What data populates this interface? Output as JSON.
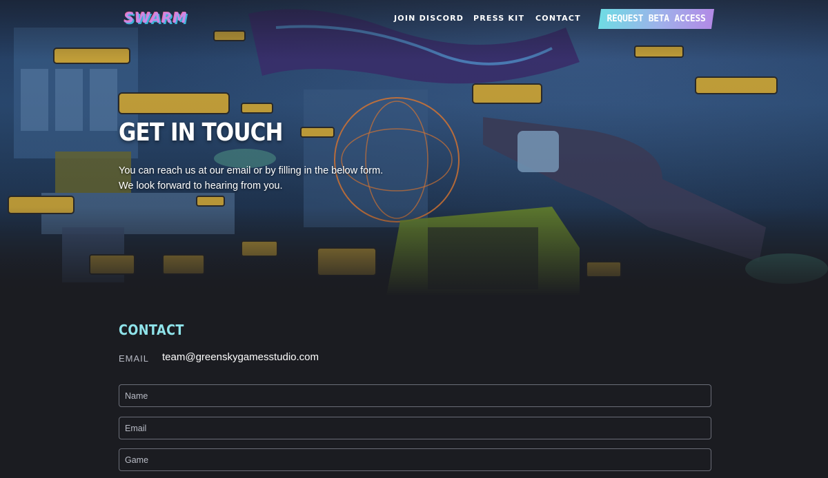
{
  "brand": {
    "logo_text": "SWARM"
  },
  "nav": {
    "links": [
      {
        "label": "JOIN DISCORD"
      },
      {
        "label": "PRESS KIT"
      },
      {
        "label": "CONTACT"
      }
    ],
    "cta_label": "REQUEST BETA ACCESS"
  },
  "hero": {
    "title": "GET IN TOUCH",
    "lines": [
      "You can reach us at our email or by filling in the below form.",
      "We look forward to hearing from you."
    ]
  },
  "contact": {
    "heading": "CONTACT",
    "email_label": "EMAIL",
    "email_value": "team@greenskygamesstudio.com",
    "fields": [
      {
        "placeholder": "Name",
        "value": ""
      },
      {
        "placeholder": "Email",
        "value": ""
      },
      {
        "placeholder": "Game",
        "value": ""
      }
    ]
  },
  "colors": {
    "background": "#1b1c21",
    "accent_cyan": "#8fe3ea",
    "cta_gradient_start": "#6fdbe4",
    "cta_gradient_end": "#b28ae6"
  }
}
